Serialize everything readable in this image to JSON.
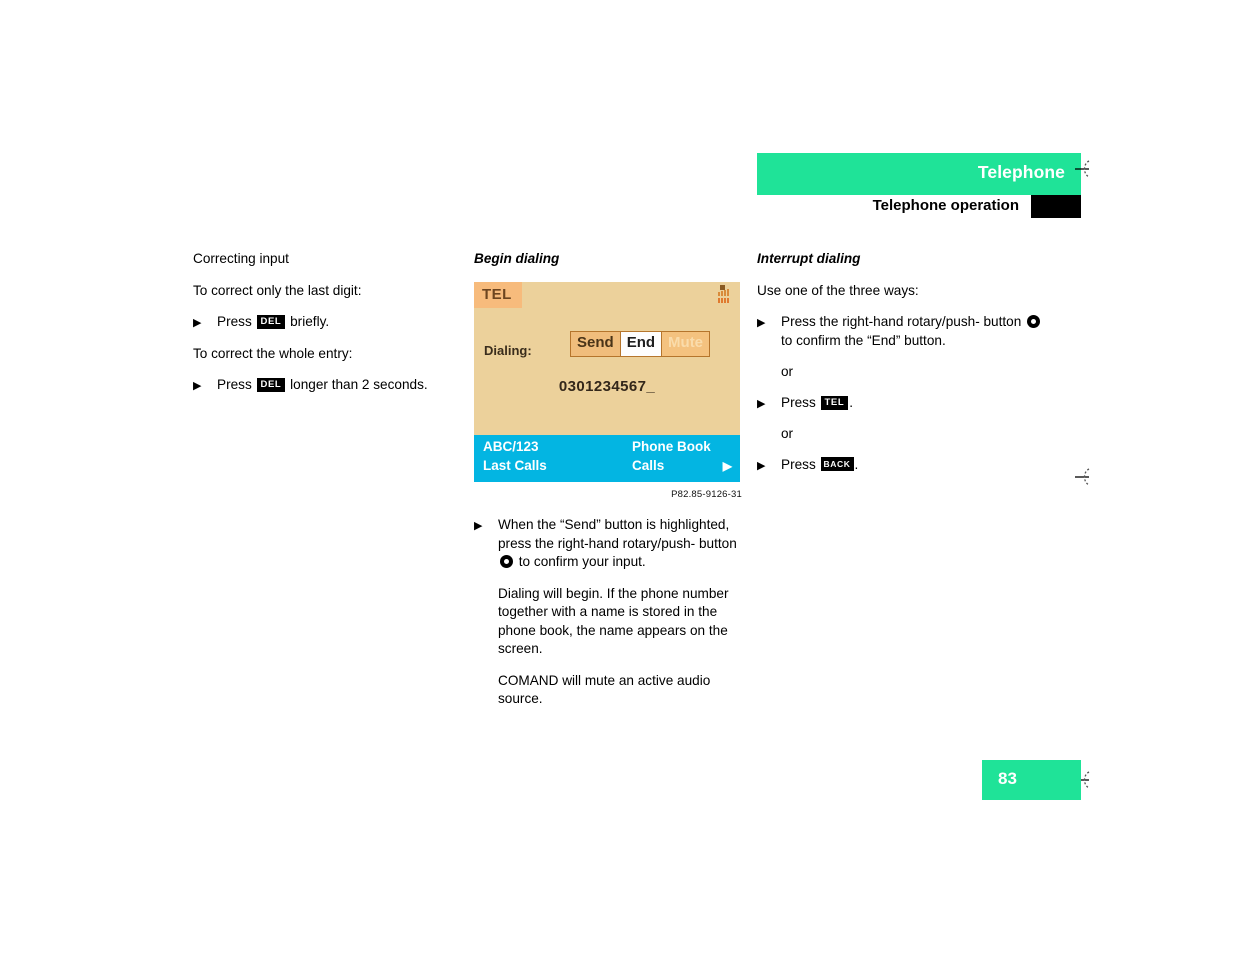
{
  "header": {
    "chapter_title": "Telephone",
    "section_title": "Telephone operation",
    "green_hex": "#1FE398",
    "black_hex": "#000000"
  },
  "columns": {
    "left": {
      "heading": "Correcting input",
      "intro_1": "To correct only the last digit:",
      "step_1_prefix": "Press",
      "step_1_key": "DEL",
      "step_1_suffix": "briefly.",
      "intro_2": "To correct the whole entry:",
      "step_2_prefix": "Press",
      "step_2_key": "DEL",
      "step_2_suffix": "longer than 2 seconds."
    },
    "center": {
      "heading": "Begin dialing",
      "figure_caption": "P82.85-9126-31",
      "step_1_line_1": "When the “Send” button is highlighted,",
      "step_1_line_2": "press the right-hand rotary/push-",
      "step_1_line_3_prefix": "button",
      "step_1_line_3_suffix": "to confirm your input.",
      "para_1": "Dialing will begin. If the phone number together with a name is stored in the phone book, the name appears on the screen.",
      "para_2": "COMAND will mute an active audio source."
    },
    "right": {
      "heading": "Interrupt dialing",
      "intro": "Use one of the three ways:",
      "step_1_line_1": "Press the right-hand rotary/push-",
      "step_1_line_2_prefix": "button",
      "step_1_line_2_suffix": "to confirm the “End” button.",
      "or_1": "or",
      "step_2_prefix": "Press",
      "step_2_key": "TEL",
      "step_2_suffix": ".",
      "or_2": "or",
      "step_3_prefix": "Press",
      "step_3_key": "BACK",
      "step_3_suffix": "."
    }
  },
  "comand_display": {
    "tel_label": "TEL",
    "dialing_label": "Dialing:",
    "button_send": "Send",
    "button_end": "End",
    "button_mute": "Mute",
    "number": "0301234567_",
    "bottom_abc123": "ABC/123",
    "bottom_last_calls": "Last Calls",
    "bottom_phone_book": "Phone Book",
    "bottom_calls": "Calls",
    "bottom_arrow": "▶",
    "signal_icon_name": "signal-strength-icon",
    "screen_bg_hex": "#ECD19B",
    "tel_tab_hex": "#F7BB7C",
    "bottom_bar_hex": "#03B5E2"
  },
  "footer": {
    "page_number": "83"
  },
  "icons": {
    "bullet_arrow": "▶",
    "rotary_push_button": "rotary-push-knob-icon",
    "cut_mark": "scissors-cut-mark-icon"
  }
}
